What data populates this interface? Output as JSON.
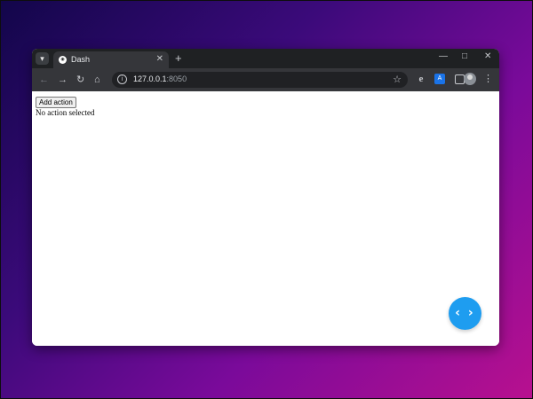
{
  "browser": {
    "tab_menu_icon": "chevron-down-icon",
    "tab": {
      "favicon": "dash-favicon",
      "title": "Dash",
      "close_glyph": "✕"
    },
    "new_tab_glyph": "+",
    "window_controls": {
      "minimize": "—",
      "maximize": "□",
      "close": "✕"
    },
    "nav": {
      "back": "←",
      "forward": "→",
      "reload": "↻",
      "home": "⌂"
    },
    "address": {
      "host": "127.0.0.1",
      "port": ":8050"
    },
    "bookmark_glyph": "☆",
    "extensions": [
      "e-icon",
      "translate-icon",
      "puzzle-icon",
      "side-panel-icon"
    ],
    "menu_glyph": "⋮"
  },
  "page": {
    "add_action_label": "Add action",
    "status_text": "No action selected",
    "fab_glyph": "‹ ›",
    "fab_color": "#1e9df0"
  }
}
